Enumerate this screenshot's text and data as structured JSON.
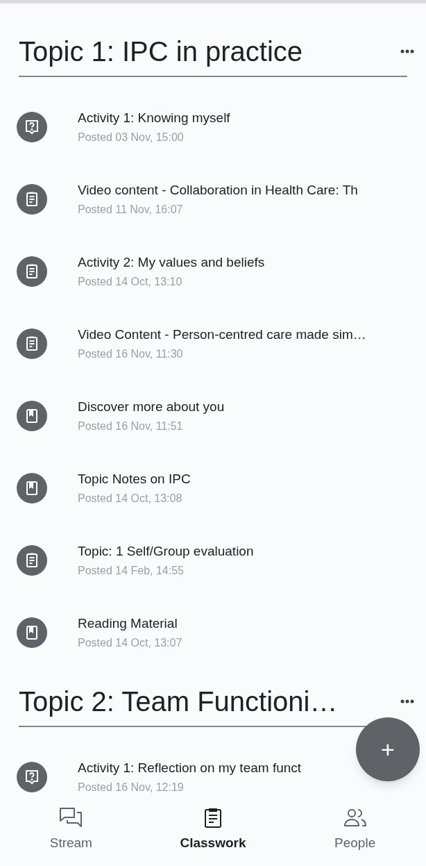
{
  "topics": [
    {
      "title": "Topic 1: IPC in practice",
      "items": [
        {
          "kind": "question",
          "title": "Activity 1: Knowing myself",
          "posted": "Posted 03 Nov, 15:00"
        },
        {
          "kind": "assignment",
          "title": "Video content - Collaboration in Health Care: Th",
          "posted": "Posted 11 Nov, 16:07"
        },
        {
          "kind": "assignment",
          "title": "Activity 2: My values and beliefs",
          "posted": "Posted 14 Oct, 13:10"
        },
        {
          "kind": "assignment",
          "title": "Video Content - Person-centred care made sim…",
          "posted": "Posted 16 Nov, 11:30"
        },
        {
          "kind": "material",
          "title": "Discover more about you",
          "posted": "Posted 16 Nov, 11:51"
        },
        {
          "kind": "material",
          "title": "Topic Notes on IPC",
          "posted": "Posted 14 Oct, 13:08"
        },
        {
          "kind": "assignment",
          "title": "Topic: 1 Self/Group evaluation",
          "posted": "Posted 14 Feb, 14:55"
        },
        {
          "kind": "material",
          "title": "Reading Material",
          "posted": "Posted 14 Oct, 13:07"
        }
      ]
    },
    {
      "title": "Topic 2: Team Functioni…",
      "items": [
        {
          "kind": "question",
          "title": "Activity 1: Reflection on my team funct",
          "posted": "Posted 16 Nov, 12:19"
        }
      ]
    }
  ],
  "fab": {
    "label": "+"
  },
  "nav": [
    {
      "kind": "stream",
      "label": "Stream",
      "selected": false
    },
    {
      "kind": "classwork",
      "label": "Classwork",
      "selected": true
    },
    {
      "kind": "people",
      "label": "People",
      "selected": false
    }
  ]
}
